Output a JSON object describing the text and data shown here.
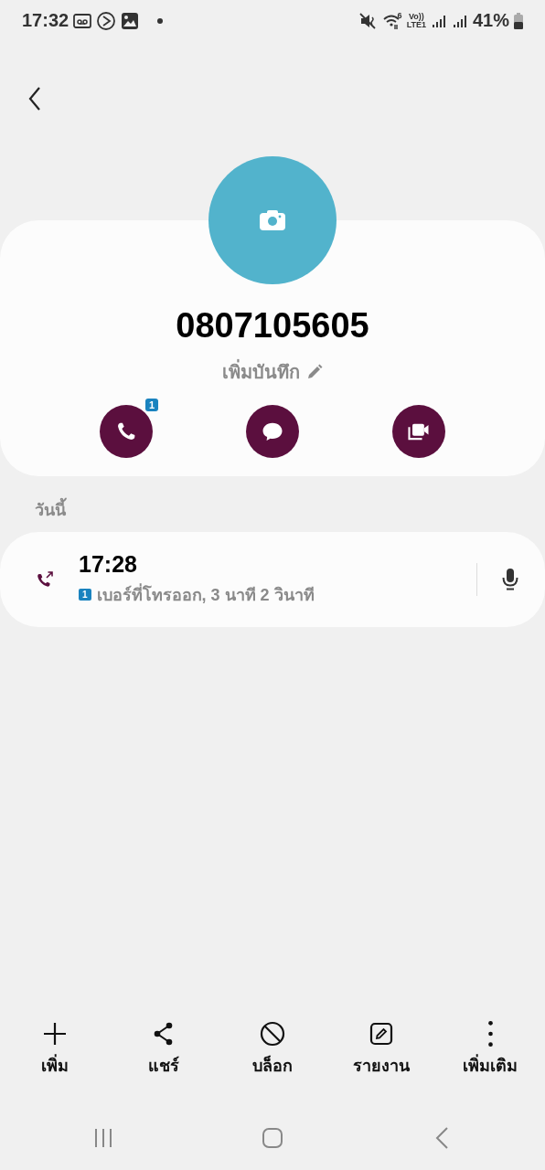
{
  "status_bar": {
    "time": "17:32",
    "wifi_label": "6",
    "volte_label": "Vo))",
    "lte_label": "LTE1",
    "battery": "41%"
  },
  "contact": {
    "name": "0807105605",
    "note": "เพิ่มบันทึก",
    "actions": [
      {
        "kind": "call",
        "badge": "1"
      },
      {
        "kind": "message"
      },
      {
        "kind": "video"
      }
    ]
  },
  "history": {
    "section": "วันนี้",
    "entries": [
      {
        "kind": "outgoing",
        "time": "17:28",
        "sim": "1",
        "detail": "เบอร์ที่โทรออก, 3 นาที 2 วินาที"
      }
    ]
  },
  "toolbar": [
    {
      "kind": "add",
      "label": "เพิ่ม"
    },
    {
      "kind": "share",
      "label": "แชร์"
    },
    {
      "kind": "block",
      "label": "บล็อก"
    },
    {
      "kind": "report",
      "label": "รายงาน"
    },
    {
      "kind": "more",
      "label": "เพิ่มเติม"
    }
  ]
}
